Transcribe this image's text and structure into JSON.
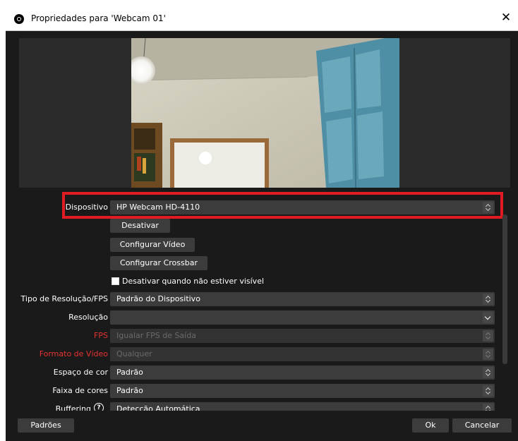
{
  "window": {
    "title": "Propriedades para 'Webcam 01'",
    "close_label": "✕"
  },
  "form": {
    "device": {
      "label": "Dispositivo",
      "value": "HP Webcam HD-4110"
    },
    "deactivate_button": "Desativar",
    "configure_video_button": "Configurar Vídeo",
    "configure_crossbar_button": "Configurar Crossbar",
    "deactivate_when_hidden": {
      "label": "Desativar quando não estiver visível",
      "checked": false
    },
    "resolution_fps_type": {
      "label": "Tipo de Resolução/FPS",
      "value": "Padrão do Dispositivo"
    },
    "resolution": {
      "label": "Resolução",
      "value": ""
    },
    "fps": {
      "label": "FPS",
      "value": "Igualar FPS de Saída"
    },
    "video_format": {
      "label": "Formato de Vídeo",
      "value": "Qualquer"
    },
    "color_space": {
      "label": "Espaço de cor",
      "value": "Padrão"
    },
    "color_range": {
      "label": "Faixa de cores",
      "value": "Padrão"
    },
    "buffering": {
      "label": "Buffering",
      "value": "Detecção Automática"
    }
  },
  "footer": {
    "defaults_button": "Padrões",
    "ok_button": "Ok",
    "cancel_button": "Cancelar"
  },
  "colors": {
    "background": "#1a1a1a",
    "control": "#3c3c3c",
    "highlight": "#e01b24",
    "warning_label": "#e63232"
  }
}
